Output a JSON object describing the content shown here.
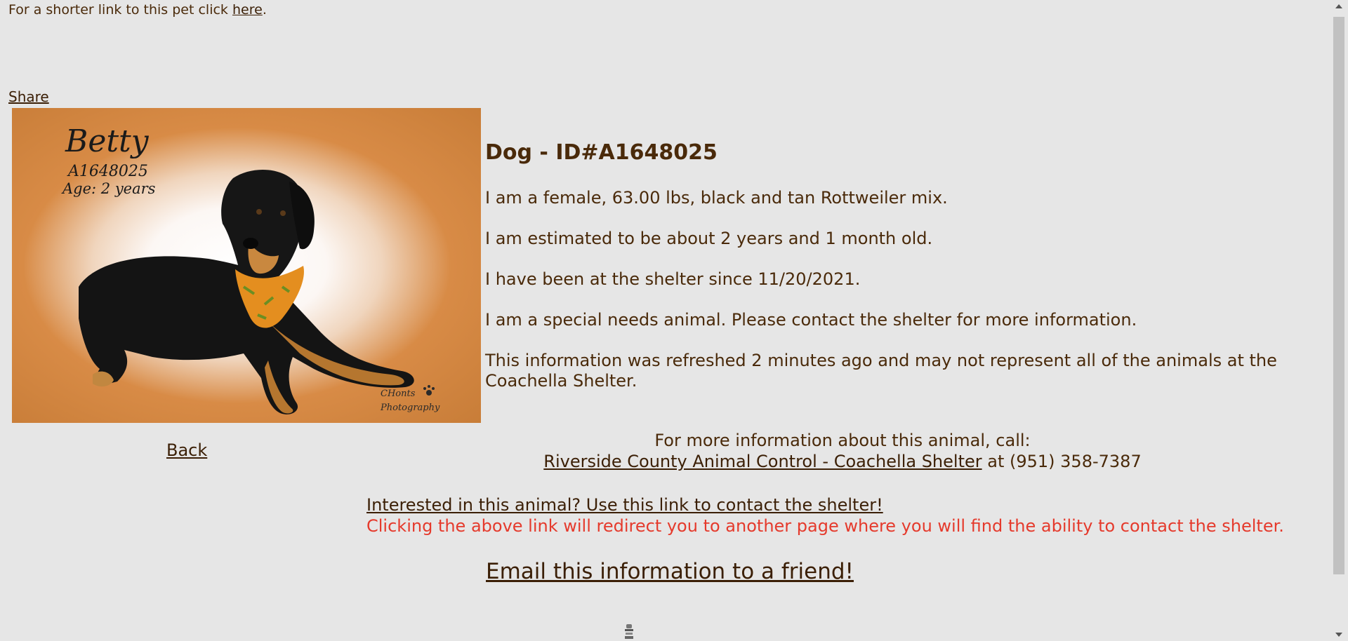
{
  "top": {
    "shortlink_prefix": "For a shorter link to this pet click ",
    "shortlink_link": "here",
    "shortlink_suffix": ".",
    "share_label": "Share"
  },
  "photo": {
    "name": "Betty",
    "id": "A1648025",
    "age": "Age: 2 years",
    "credit_line1": "CHonts",
    "credit_line2": "Photography"
  },
  "back_label": "Back",
  "details": {
    "heading": "Dog - ID#A1648025",
    "line1": "I am a female, 63.00 lbs, black and tan Rottweiler mix.",
    "line2": "I am estimated to be about 2 years and 1 month old.",
    "line3": "I have been at the shelter since 11/20/2021.",
    "line4": "I am a special needs animal. Please contact the shelter for more information.",
    "line5": "This information was refreshed 2 minutes ago and may not represent all of the animals at the Coachella Shelter."
  },
  "call": {
    "prompt": "For more information about this animal, call:",
    "shelter_link": "Riverside County Animal Control - Coachella Shelter",
    "phone": " at (951) 358-7387"
  },
  "contact": {
    "link": "Interested in this animal? Use this link to contact the shelter!",
    "warning": "Clicking the above link will redirect you to another page where you will find the ability to contact the shelter."
  },
  "email_label": "Email this information to a friend!",
  "colors": {
    "background": "#e6e6e6",
    "text": "#4a2a0a",
    "warning": "#e53a2c",
    "photo_frame": "#c87d38"
  }
}
